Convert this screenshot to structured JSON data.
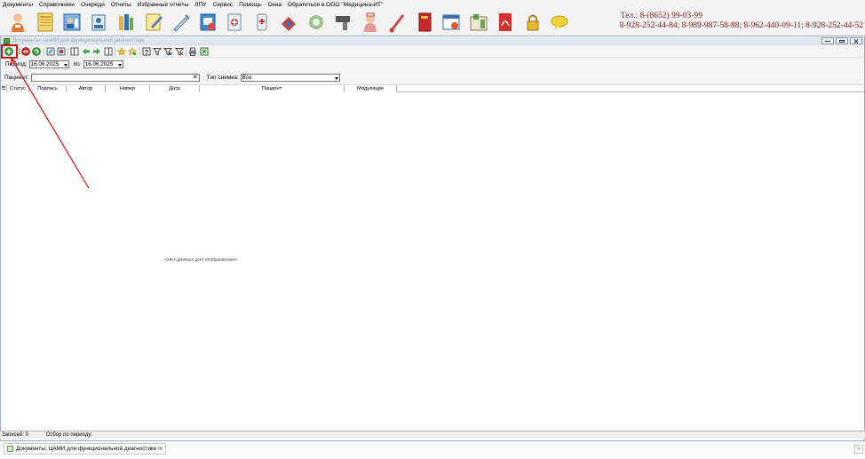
{
  "menu": [
    "Документы",
    "Справочники",
    "Очереди",
    "Отчеты",
    "Избранные отчеты",
    "ЛПУ",
    "Сервис",
    "Помощь",
    "Окна",
    "Обратиться в ООО \"Медицина-ИТ\""
  ],
  "toolbar_icons": [
    "doctor-icon",
    "journal-icon",
    "patient-card-icon",
    "registry-icon",
    "books-icon",
    "notes-icon",
    "syringe-icon",
    "schedule-icon",
    "lab-icon",
    "medicine-icon",
    "pills-icon",
    "capsule-icon",
    "barcode-scanner-icon",
    "nurse-icon",
    "thermometer-icon",
    "red-book-icon",
    "calendar-icon",
    "calculator-icon",
    "pdf-icon",
    "lock-icon",
    "chat-icon"
  ],
  "contact": {
    "line1": "Тел.: 8-(8652) 99-03-99",
    "line2": "8-928-252-44-84; 8-989-987-58-88; 8-962-440-09-11; 8-928-252-44-52"
  },
  "window": {
    "title": "Документы: ЦАМИ для функциональной диагностики"
  },
  "small_toolbar": [
    "add-icon",
    "list-icon",
    "delete-icon",
    "refresh-icon",
    "export-icon",
    "import-icon",
    "columns-icon",
    "prev-icon",
    "next-icon",
    "columns2-icon",
    "favorite-icon",
    "favorite-add-icon",
    "help-icon",
    "filter-icon",
    "filter-edit-icon",
    "filter-clear-icon",
    "print-icon",
    "excel-icon"
  ],
  "filters": {
    "period_label": "Период:",
    "date_from": "16.06.2025",
    "to_label": "по",
    "date_to": "16.06.2025",
    "patient_label": "Пациент:",
    "patient_value": "",
    "image_type_label": "Тип снимка:",
    "image_type_value": "Все"
  },
  "grid": {
    "columns": [
      "Статус",
      "Подпись",
      "Автор",
      "Номер",
      "Дата",
      "Пациент",
      "Модуляция"
    ],
    "empty_text": "<Нет данных для отображения>"
  },
  "status": {
    "records": "Записей: 0",
    "filter": "Отбор по периоду:"
  },
  "taskbar": {
    "task_label": "Документы: ЦАМИ для функциональной диагностики"
  },
  "colors": {
    "annotation": "#d01010",
    "contact_text": "#8b1a1a"
  }
}
